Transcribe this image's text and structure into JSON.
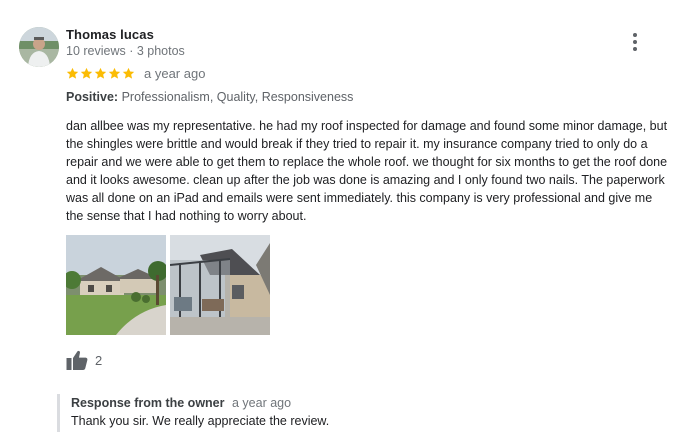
{
  "review": {
    "reviewer_name": "Thomas lucas",
    "reviewer_meta": "10 reviews · 3 photos",
    "rating": 5,
    "rating_max": 5,
    "date": "a year ago",
    "highlights_label": "Positive:",
    "highlights_value": "Professionalism, Quality, Responsiveness",
    "text": "dan allbee was my representative. he had my roof inspected for damage and found some minor damage, but the shingles were brittle and would break if they tried to repair it. my insurance company tried to only do a repair and we were able to get them to replace the whole roof. we thought for six months to get the roof done and it looks awesome. clean up after the job was done is amazing and I only found two nails. The paperwork was all done on an iPad and emails were sent immediately. this company is very professional and give me the sense that I had nothing to worry about.",
    "helpful_count": "2",
    "star_color": "#fbbc04",
    "icons": {
      "more": "more-vert-icon",
      "star": "star-icon",
      "helpful": "thumbs-up-icon"
    }
  },
  "owner_response": {
    "title": "Response from the owner",
    "date": "a year ago",
    "text": "Thank you sir. We really appreciate the review."
  }
}
